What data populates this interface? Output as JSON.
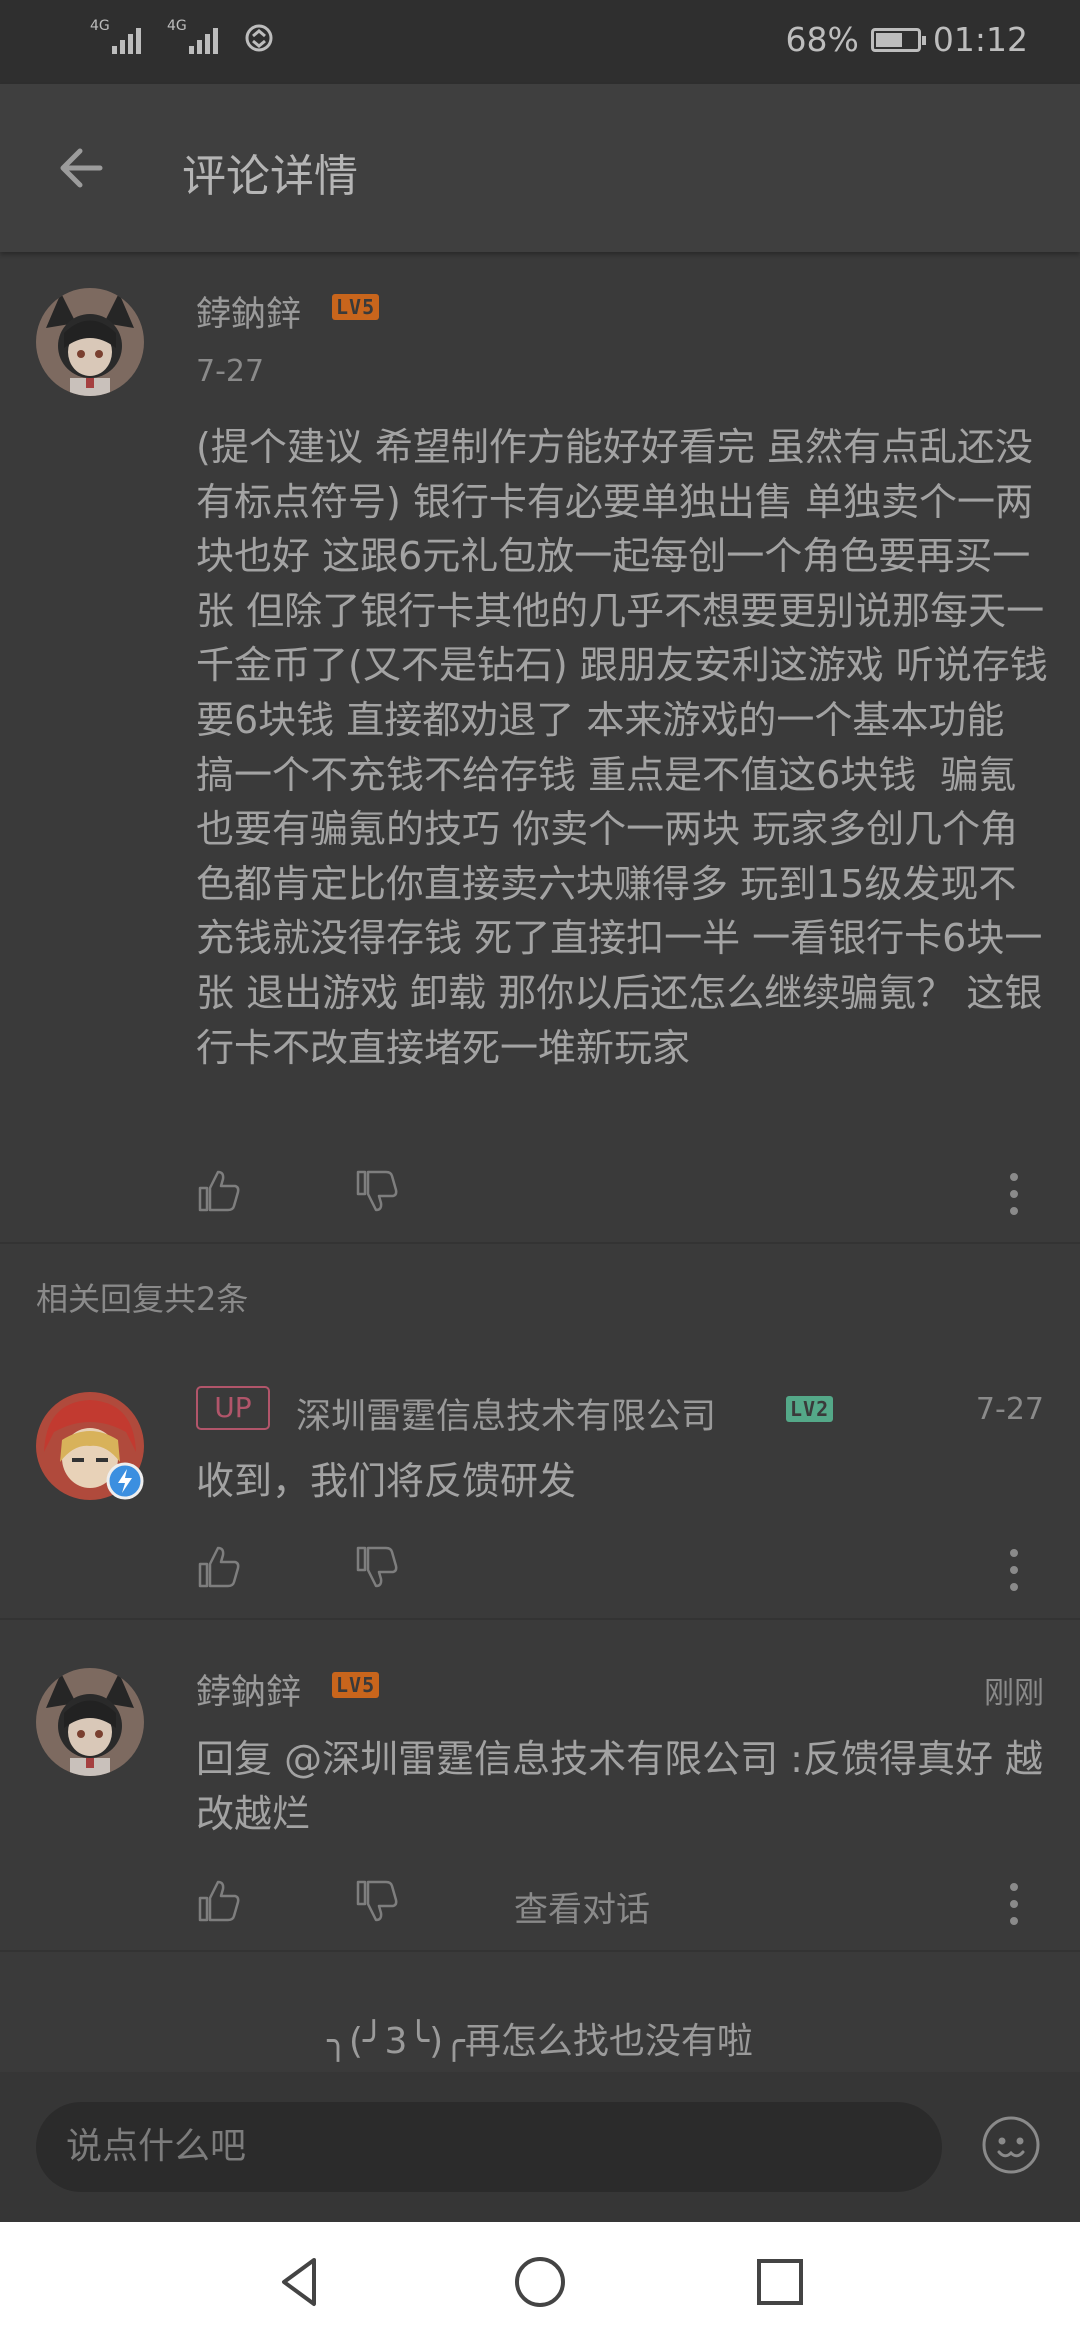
{
  "status_bar": {
    "net1": "4G",
    "net2": "4G",
    "battery": "68%",
    "time": "01:12"
  },
  "header": {
    "title": "评论详情"
  },
  "main_comment": {
    "user": "鋍鈉鋅",
    "level": "LV5",
    "date": "7-27",
    "text": "(提个建议 希望制作方能好好看完 虽然有点乱还没有标点符号) 银行卡有必要单独出售 单独卖个一两块也好 这跟6元礼包放一起每创一个角色要再买一张 但除了银行卡其他的几乎不想要更别说那每天一千金币了(又不是钻石) 跟朋友安利这游戏 听说存钱要6块钱 直接都劝退了 本来游戏的一个基本功能 搞一个不充钱不给存钱 重点是不值这6块钱  骗氪也要有骗氪的技巧 你卖个一两块 玩家多创几个角色都肯定比你直接卖六块赚得多 玩到15级发现不充钱就没得存钱 死了直接扣一半 一看银行卡6块一张 退出游戏 卸载 那你以后还怎么继续骗氪？ 这银行卡不改直接堵死一堆新玩家"
  },
  "replies_label": "相关回复共2条",
  "replies": [
    {
      "tag": "UP",
      "user": "深圳雷霆信息技术有限公司",
      "level": "LV2",
      "date": "7-27",
      "text": "收到，我们将反馈研发"
    },
    {
      "user": "鋍鈉鋅",
      "level": "LV5",
      "date": "刚刚",
      "text": "回复 @深圳雷霆信息技术有限公司 :反馈得真好 越改越烂",
      "link": "查看对话"
    }
  ],
  "end_note": "╮(╯3╰)╭再怎么找也没有啦",
  "input": {
    "placeholder": "说点什么吧"
  },
  "icons": {
    "back": "arrow-left-icon",
    "like": "thumbs-up-icon",
    "dislike": "thumbs-down-icon",
    "more": "more-vertical-icon",
    "emoji": "smiley-icon",
    "verified": "lightning-badge-icon",
    "nav_back": "triangle-back-icon",
    "nav_home": "circle-home-icon",
    "nav_recent": "square-recents-icon"
  },
  "colors": {
    "background": "#3a3a3a",
    "appbar": "#3f3f3f",
    "lv5": "#c8651c",
    "lv2": "#54a888",
    "up_tag": "#b1556a",
    "verified": "#3b8fe0"
  }
}
